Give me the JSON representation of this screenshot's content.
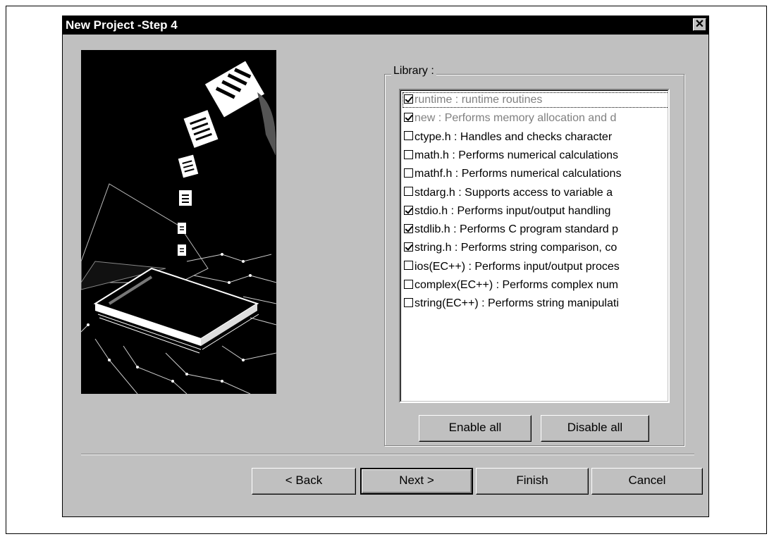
{
  "dialog": {
    "title": "New Project -Step 4",
    "close_label": "✕"
  },
  "library": {
    "label": "Library :",
    "items": [
      {
        "text": "runtime : runtime routines",
        "checked": true,
        "dim": true
      },
      {
        "text": "new : Performs memory allocation and d",
        "checked": true,
        "dim": true
      },
      {
        "text": "ctype.h : Handles and checks character",
        "checked": false,
        "dim": false
      },
      {
        "text": "math.h : Performs numerical calculations",
        "checked": false,
        "dim": false
      },
      {
        "text": "mathf.h : Performs numerical calculations",
        "checked": false,
        "dim": false
      },
      {
        "text": "stdarg.h : Supports access to variable a",
        "checked": false,
        "dim": false
      },
      {
        "text": "stdio.h : Performs input/output handling",
        "checked": true,
        "dim": false
      },
      {
        "text": "stdlib.h : Performs C program standard p",
        "checked": true,
        "dim": false
      },
      {
        "text": "string.h : Performs string comparison, co",
        "checked": true,
        "dim": false
      },
      {
        "text": "ios(EC++) : Performs input/output proces",
        "checked": false,
        "dim": false
      },
      {
        "text": "complex(EC++) : Performs complex num",
        "checked": false,
        "dim": false
      },
      {
        "text": "string(EC++) : Performs string manipulati",
        "checked": false,
        "dim": false
      }
    ],
    "enable_all": "Enable all",
    "disable_all": "Disable all"
  },
  "buttons": {
    "back": "< Back",
    "next": "Next >",
    "finish": "Finish",
    "cancel": "Cancel"
  }
}
